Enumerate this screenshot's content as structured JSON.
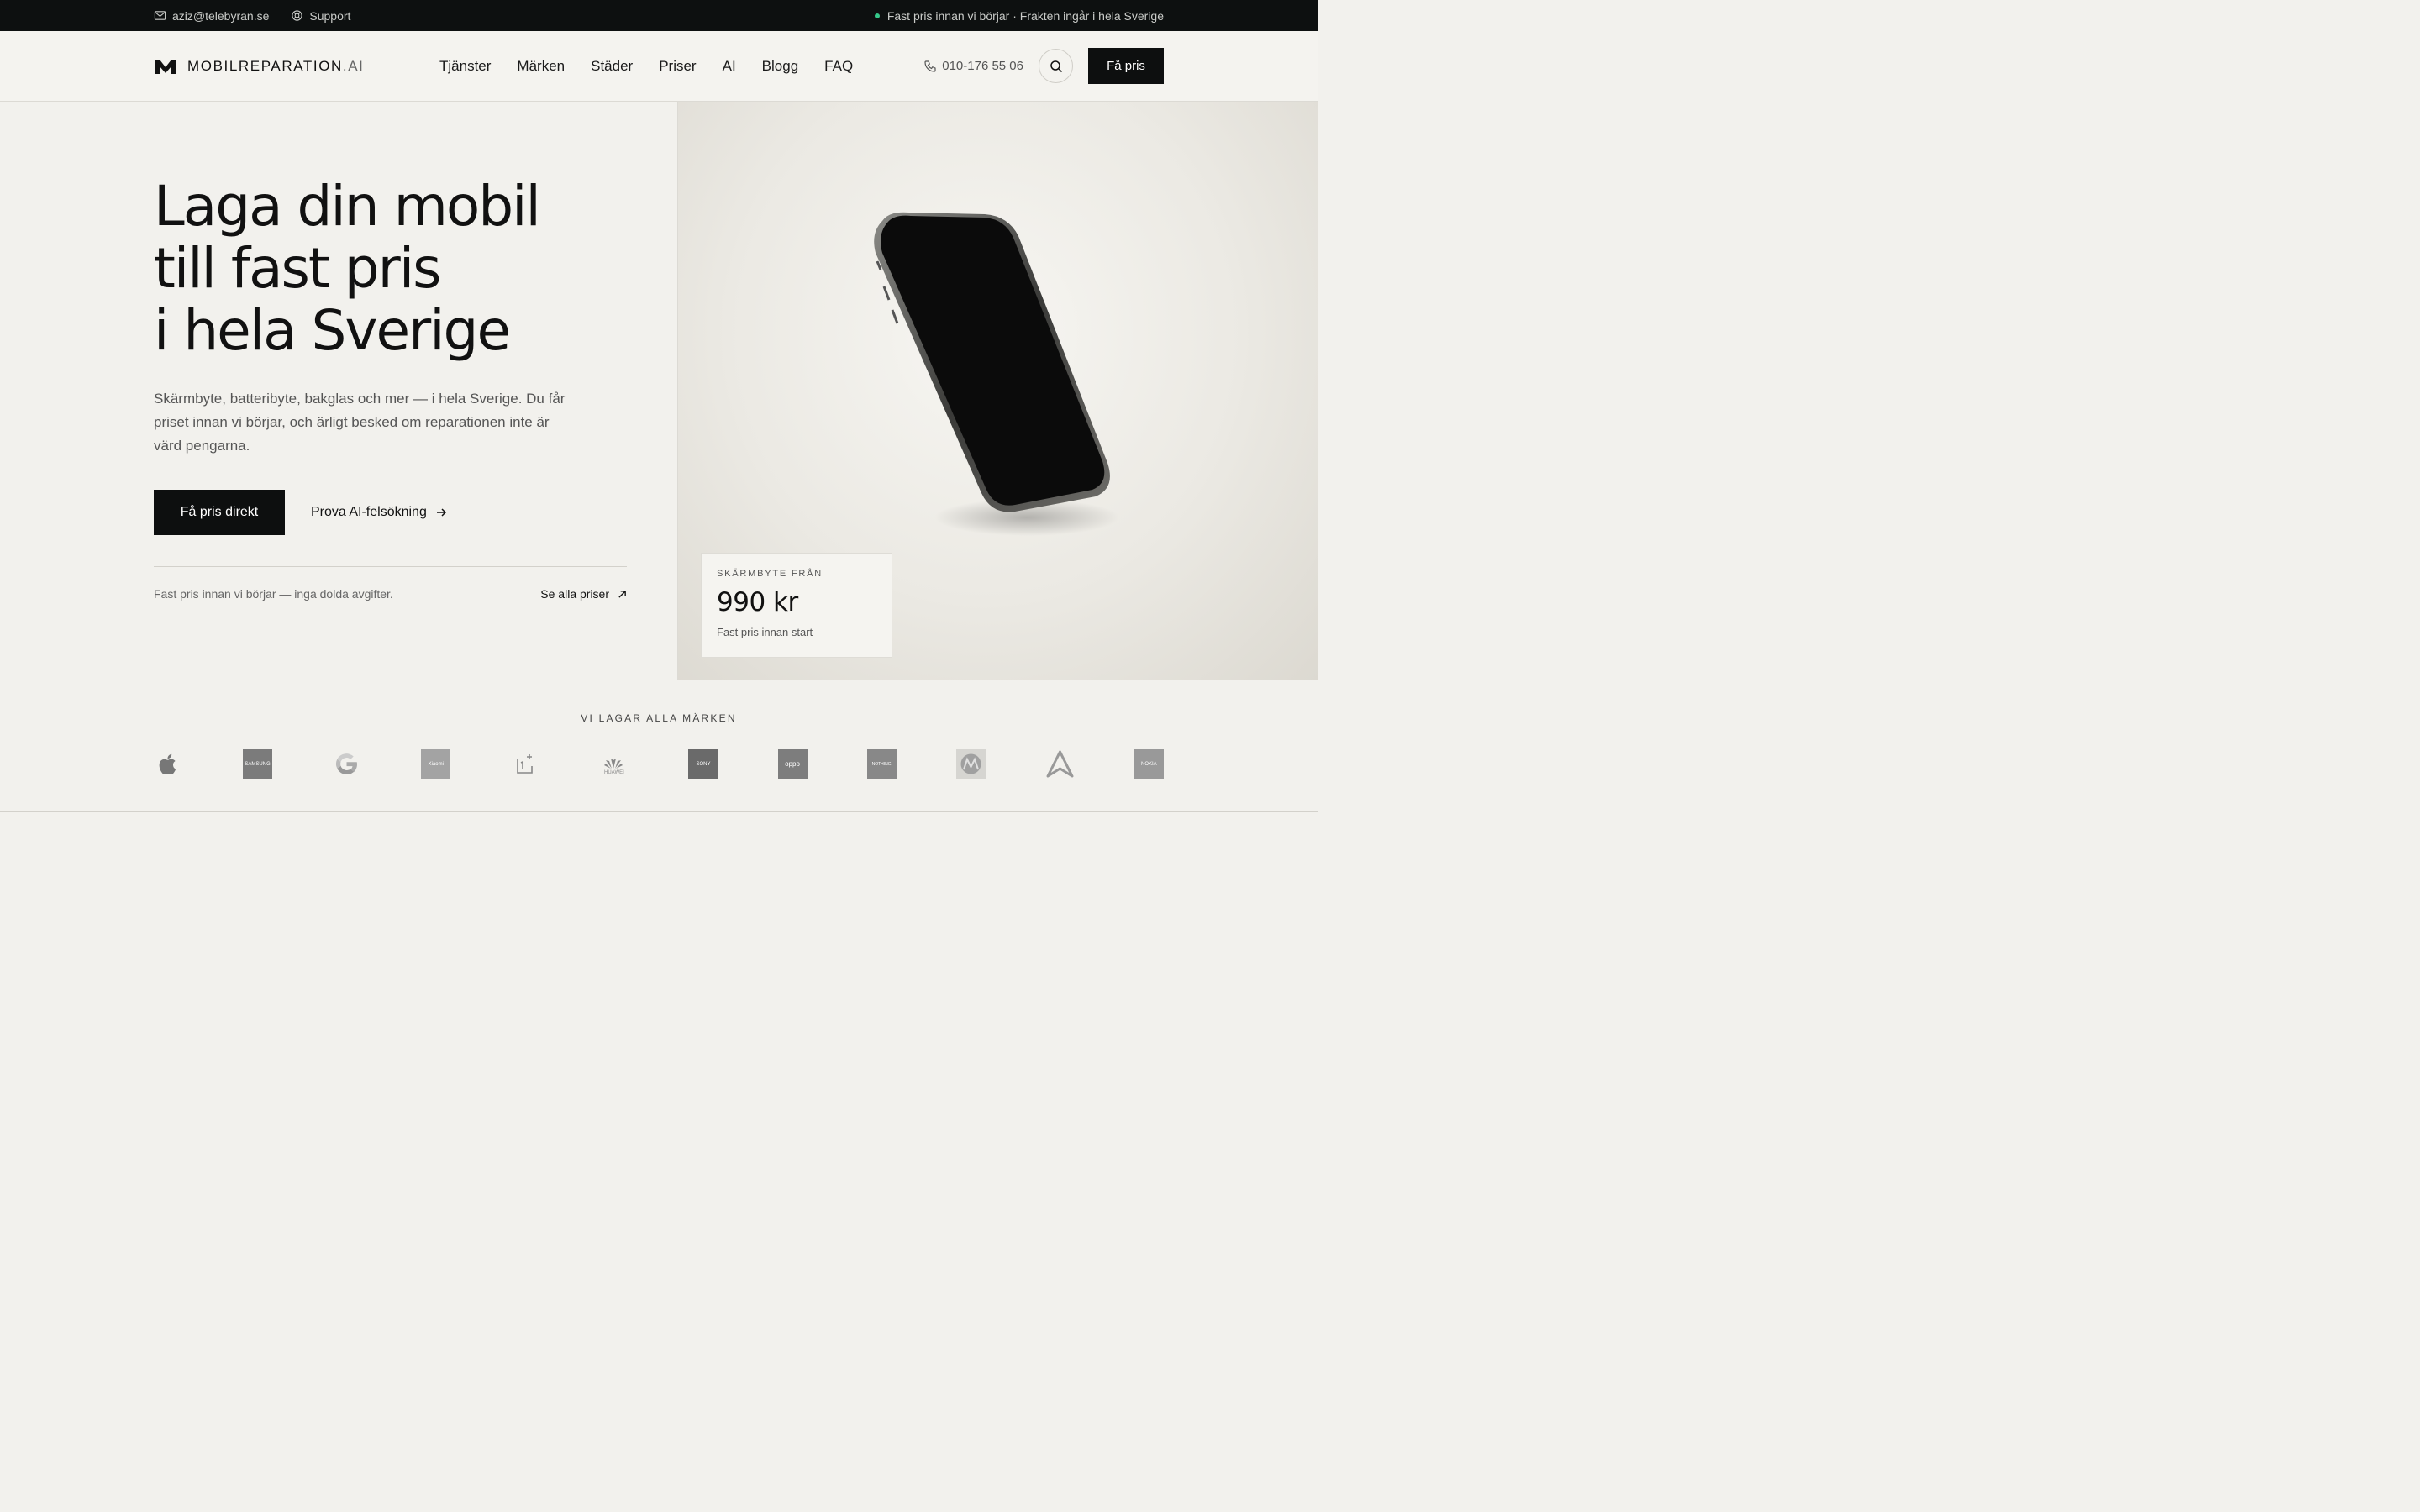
{
  "topbar": {
    "email": "aziz@telebyran.se",
    "support": "Support",
    "status": "Fast pris innan vi börjar · Frakten ingår i hela Sverige"
  },
  "header": {
    "logo_main": "MOBILREPARATION",
    "logo_suffix": ".AI",
    "nav": [
      "Tjänster",
      "Märken",
      "Städer",
      "Priser",
      "AI",
      "Blogg",
      "FAQ"
    ],
    "phone": "010-176 55 06",
    "cta": "Få pris"
  },
  "hero": {
    "title_line1": "Laga din mobil",
    "title_line2": "till fast pris",
    "title_line3": "i hela Sverige",
    "lead": "Skärmbyte, batteribyte, bakglas och mer — i hela Sverige. Du får priset innan vi börjar, och ärligt besked om reparationen inte är värd pengarna.",
    "primary_button": "Få pris direkt",
    "secondary_button": "Prova AI-felsökning",
    "note": "Fast pris innan vi börjar — inga dolda avgifter.",
    "all_prices": "Se alla priser"
  },
  "price_card": {
    "label": "SKÄRMBYTE FRÅN",
    "value": "990 kr",
    "sub": "Fast pris innan start"
  },
  "brands": {
    "title": "VI LAGAR ALLA MÄRKEN",
    "items": [
      {
        "name": "apple-logo",
        "text": ""
      },
      {
        "name": "samsung-logo",
        "text": "SAMSUNG"
      },
      {
        "name": "google-logo",
        "text": ""
      },
      {
        "name": "xiaomi-logo",
        "text": "Xiaomi"
      },
      {
        "name": "oneplus-logo",
        "text": ""
      },
      {
        "name": "huawei-logo",
        "text": "HUAWEI"
      },
      {
        "name": "sony-logo",
        "text": "SONY"
      },
      {
        "name": "oppo-logo",
        "text": "oppo"
      },
      {
        "name": "nothing-logo",
        "text": "NOTHING"
      },
      {
        "name": "motorola-logo",
        "text": ""
      },
      {
        "name": "asus-logo",
        "text": ""
      },
      {
        "name": "nokia-logo",
        "text": "NOKIA"
      }
    ]
  }
}
